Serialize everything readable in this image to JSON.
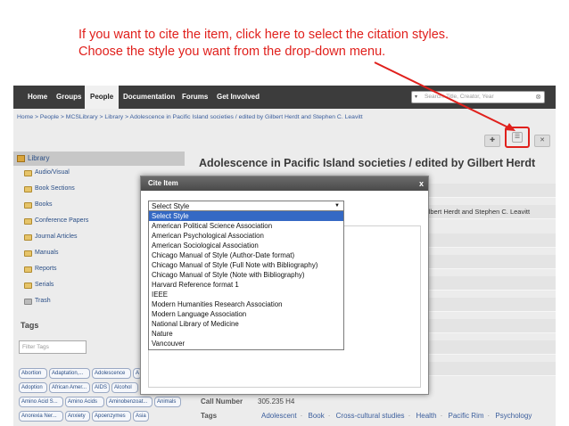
{
  "annotation": {
    "line1": "If you want to cite the item, click here to select the citation styles.",
    "line2": "Choose the style you want from the drop-down menu."
  },
  "nav": {
    "items": [
      "Home",
      "Groups",
      "People",
      "Documentation",
      "Forums",
      "Get Involved"
    ],
    "active": "People",
    "search_placeholder": "Search: Title, Creator, Year"
  },
  "breadcrumb": "Home > People > MCSLibrary > Library > Adolescence in Pacific Island societies / edited by Gilbert Herdt and Stephen C. Leavitt",
  "sidebar": {
    "library_label": "Library",
    "collections": [
      "Audio/Visual",
      "Book Sections",
      "Books",
      "Conference Papers",
      "Journal Articles",
      "Manuals",
      "Reports",
      "Serials",
      "Trash"
    ],
    "tags_title": "Tags",
    "filter_placeholder": "Filter Tags",
    "tags": [
      "Abortion",
      "Adaptation,...",
      "Adolescence",
      "A",
      "Adoption",
      "African Amer...",
      "AIDS",
      "Alcohol",
      "Amino Acid S...",
      "Amino Acids",
      "Aminobenzoat...",
      "Animals",
      "Anorexia Ner...",
      "Anxiety",
      "Apoenzymes",
      "Asia"
    ]
  },
  "item": {
    "title": "Adolescence in Pacific Island societies / edited by Gilbert Herdt",
    "creator_tail": "ilbert Herdt and Stephen C. Leavitt",
    "call_number_label": "Call Number",
    "call_number_value": "305.235 H4",
    "tags_label": "Tags",
    "tags": [
      "Adolescent",
      "Book",
      "Cross-cultural studies",
      "Health",
      "Pacific Rim",
      "Psychology"
    ]
  },
  "dialog": {
    "title": "Cite Item",
    "close": "x",
    "select_value": "Select Style",
    "options": [
      "Select Style",
      "American Political Science Association",
      "American Psychological Association",
      "American Sociological Association",
      "Chicago Manual of Style (Author-Date format)",
      "Chicago Manual of Style (Full Note with Bibliography)",
      "Chicago Manual of Style (Note with Bibliography)",
      "Harvard Reference format 1",
      "IEEE",
      "Modern Humanities Research Association",
      "Modern Language Association",
      "National Library of Medicine",
      "Nature",
      "Vancouver"
    ]
  },
  "colors": {
    "annotation": "#e0201c",
    "nav_bg": "#3c3c3c",
    "link": "#3a5d9c",
    "selected_option": "#3569c4"
  },
  "icons": {
    "add_to_collection": "add-icon",
    "cite": "list-icon",
    "remove": "remove-icon"
  }
}
